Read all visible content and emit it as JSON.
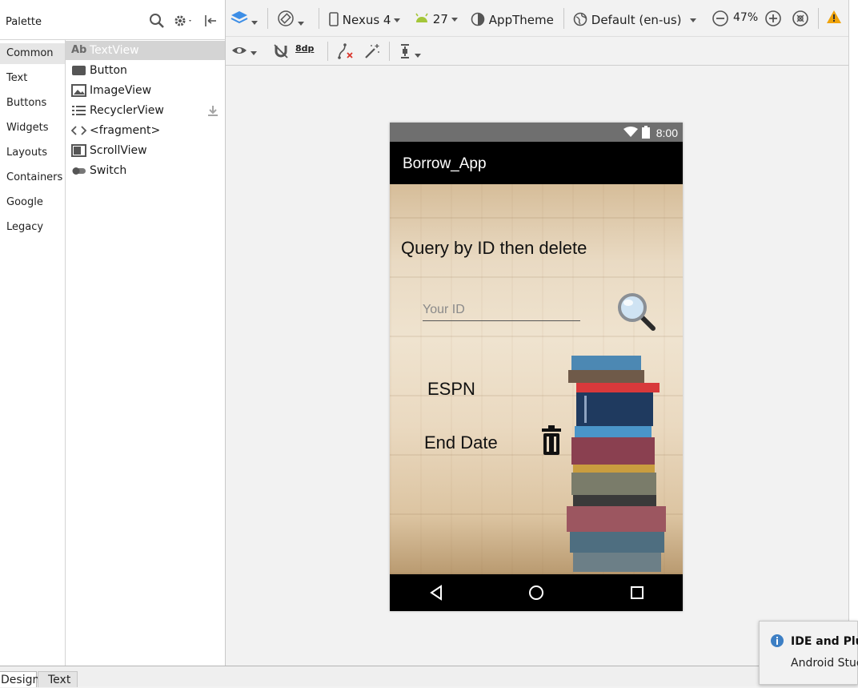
{
  "palette": {
    "title": "Palette",
    "categories": [
      "Common",
      "Text",
      "Buttons",
      "Widgets",
      "Layouts",
      "Containers",
      "Google",
      "Legacy"
    ],
    "widgets": [
      {
        "prefix": "Ab",
        "label": "TextView"
      },
      {
        "label": "Button"
      },
      {
        "label": "ImageView"
      },
      {
        "label": "RecyclerView"
      },
      {
        "label": "<fragment>"
      },
      {
        "label": "ScrollView"
      },
      {
        "label": "Switch"
      }
    ]
  },
  "toolbar": {
    "device": "Nexus 4",
    "api_level": "27",
    "theme": "AppTheme",
    "locale": "Default (en-us)",
    "zoom": "47%",
    "margin": "8dp"
  },
  "phone": {
    "clock": "8:00",
    "app_title": "Borrow_App",
    "query_title": "Query by ID then delete",
    "id_placeholder": "Your ID",
    "name_value": "ESPN",
    "end_date_label": "End Date"
  },
  "bottom_tabs": [
    "Design",
    "Text"
  ],
  "notification": {
    "title": "IDE and Plug",
    "body": "Android Stud"
  },
  "colors": {
    "status_bar": "#6f6f6f",
    "app_bar": "#000000",
    "warning": "#f0a30a",
    "layers_blue": "#3d8ee6",
    "android_green": "#a4c639"
  }
}
